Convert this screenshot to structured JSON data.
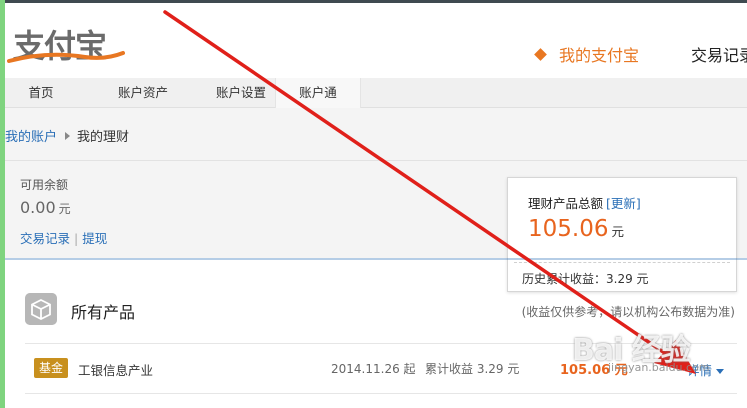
{
  "header": {
    "logo_text": "支付宝",
    "nav_current": "我的支付宝",
    "nav_next": "交易记录"
  },
  "subnav": {
    "items": [
      "首页",
      "账户资产",
      "账户设置",
      "账户通"
    ]
  },
  "breadcrumb": {
    "link": "我的账户",
    "current": "我的理财"
  },
  "balance": {
    "label": "可用余额",
    "value": "0.00",
    "unit": "元",
    "link_records": "交易记录",
    "separator": "|",
    "link_withdraw": "提现"
  },
  "summary_card": {
    "title": "理财产品总额",
    "refresh": "[更新]",
    "amount": "105.06",
    "unit": "元",
    "history": "历史累计收益：3.29 元"
  },
  "products": {
    "title": "所有产品",
    "note": "(收益仅供参考，请以机构公布数据为准)",
    "rows": [
      {
        "badge": "基金",
        "name": "工银信息产业",
        "date": "2014.11.26 起",
        "income": "累计收益 3.29 元",
        "amount": "105.06 元",
        "detail": "详情"
      }
    ]
  },
  "watermark": {
    "main": "Bai 经验",
    "sub": "jingyan.baidu.com"
  },
  "colors": {
    "accent_orange": "#e87722",
    "amount_orange": "#e8641e",
    "link_blue": "#2a6fb7",
    "badge_gold": "#c8901e",
    "arrow_red": "#e0201a"
  }
}
